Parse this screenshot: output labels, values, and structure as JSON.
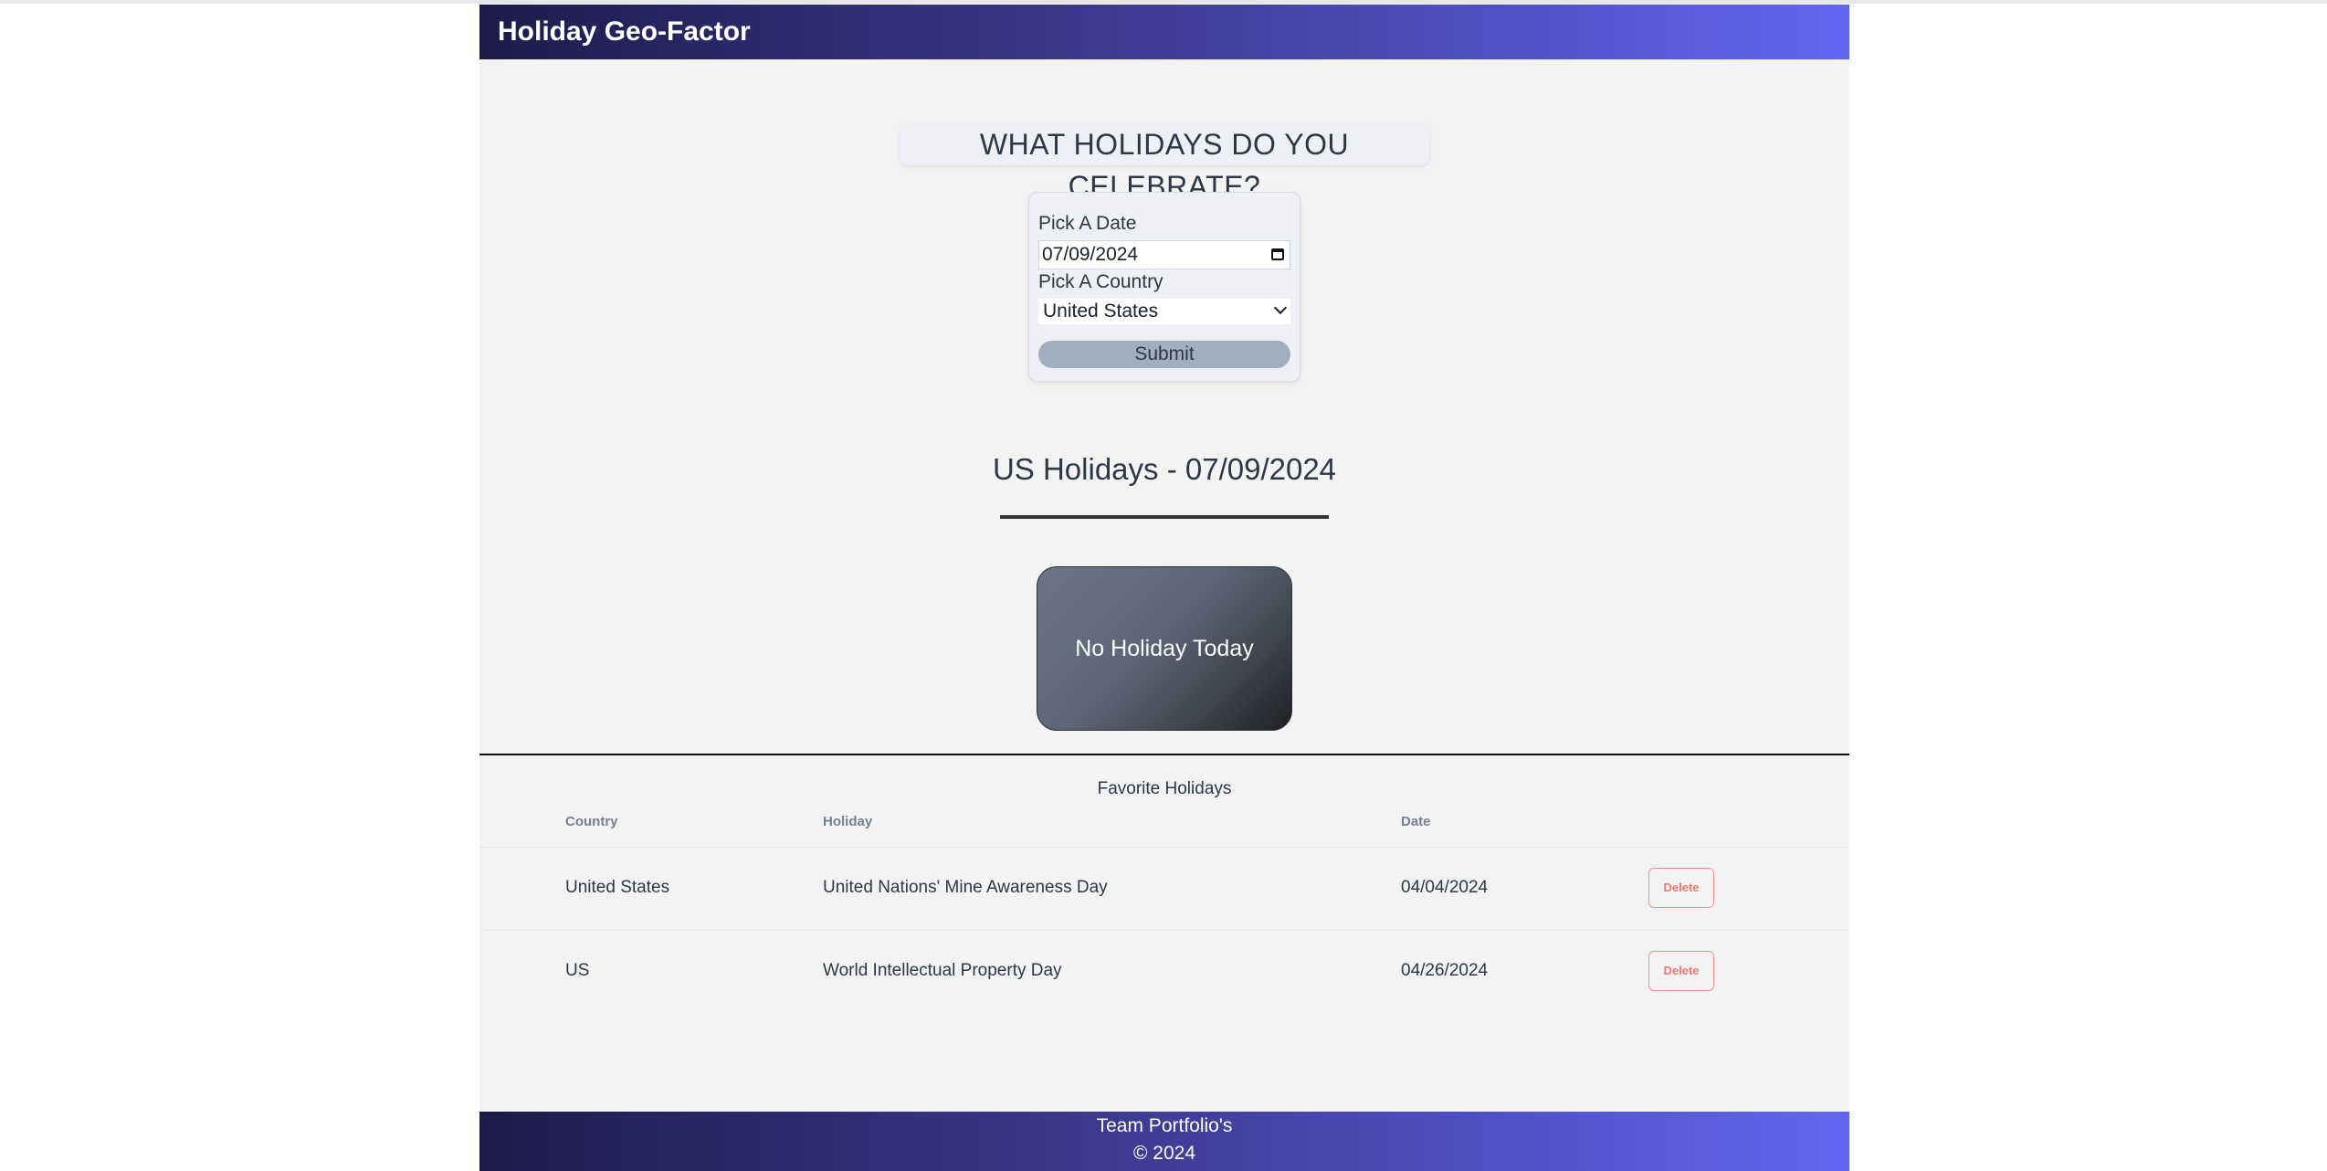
{
  "header": {
    "title": "Holiday Geo-Factor"
  },
  "hero": {
    "title": "WHAT HOLIDAYS DO YOU CELEBRATE?"
  },
  "form": {
    "date_label": "Pick A Date",
    "date_value": "07/09/2024",
    "country_label": "Pick A Country",
    "country_value": "United States",
    "submit_label": "Submit"
  },
  "result": {
    "heading": "US Holidays - 07/09/2024",
    "card_text": "No Holiday Today"
  },
  "favorites": {
    "title": "Favorite Holidays",
    "columns": [
      "Country",
      "Holiday",
      "Date"
    ],
    "rows": [
      {
        "country": "United States",
        "holiday": "United Nations' Mine Awareness Day",
        "date": "04/04/2024",
        "action": "Delete"
      },
      {
        "country": "US",
        "holiday": "World Intellectual Property Day",
        "date": "04/26/2024",
        "action": "Delete"
      }
    ]
  },
  "footer": {
    "line1": "Team Portfolio's",
    "line2": "© 2024"
  },
  "colors": {
    "header_gradient_start": "#1e1b4b",
    "header_gradient_end": "#6366f1",
    "submit_bg": "#a0aec0",
    "delete_accent": "#f0766e"
  },
  "icons": {
    "date_picker": "calendar-icon",
    "select": "chevron-down-icon"
  }
}
